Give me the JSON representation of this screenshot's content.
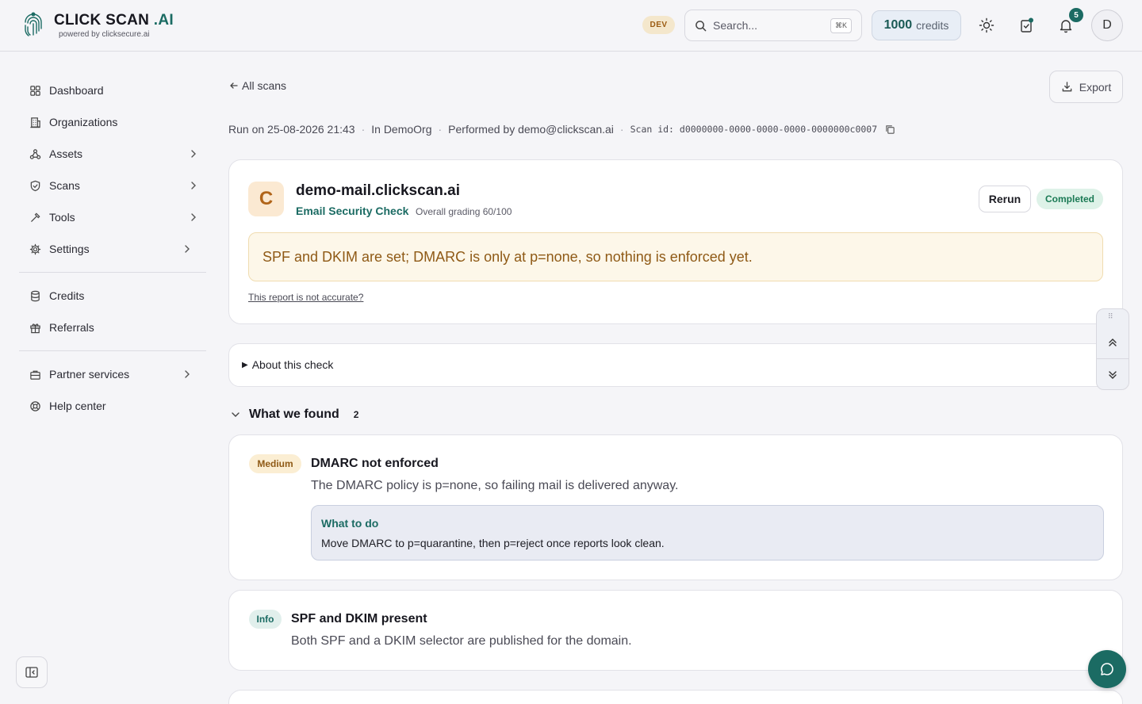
{
  "header": {
    "brand_main": "CLICK SCAN ",
    "brand_ai": ".AI",
    "brand_sub": "powered by clicksecure.ai",
    "env_badge": "DEV",
    "search_placeholder": "Search...",
    "search_shortcut": "⌘K",
    "credits_value": "1000",
    "credits_label": "credits",
    "notification_count": "5",
    "avatar_initial": "D"
  },
  "sidebar": {
    "items": [
      {
        "label": "Dashboard",
        "icon": "grid-icon"
      },
      {
        "label": "Organizations",
        "icon": "building-icon"
      },
      {
        "label": "Assets",
        "icon": "network-icon"
      },
      {
        "label": "Scans",
        "icon": "shield-icon"
      },
      {
        "label": "Tools",
        "icon": "hammer-icon"
      },
      {
        "label": "Settings",
        "icon": "gear-icon"
      },
      {
        "label": "Credits",
        "icon": "database-icon"
      },
      {
        "label": "Referrals",
        "icon": "gift-icon"
      },
      {
        "label": "Partner services",
        "icon": "briefcase-icon"
      },
      {
        "label": "Help center",
        "icon": "lifebuoy-icon"
      }
    ]
  },
  "main": {
    "back_label": "All scans",
    "export_label": "Export",
    "meta": {
      "run_on": "Run on 25-08-2026 21:43",
      "org": "In DemoOrg",
      "performed_by": "Performed by demo@clickscan.ai",
      "scan_id": "Scan id: d0000000-0000-0000-0000-0000000c0007"
    },
    "result": {
      "grade": "C",
      "domain": "demo-mail.clickscan.ai",
      "check_name": "Email Security Check",
      "grading": "Overall grading 60/100",
      "rerun_label": "Rerun",
      "status": "Completed",
      "summary": "SPF and DKIM are set; DMARC is only at p=none, so nothing is enforced yet.",
      "accuracy_link": "This report is not accurate?"
    },
    "about_label": "About this check",
    "findings_title": "What we found",
    "findings_count": "2",
    "findings": [
      {
        "severity": "Medium",
        "title": "DMARC not enforced",
        "description": "The DMARC policy is p=none, so failing mail is delivered anyway.",
        "todo_heading": "What to do",
        "todo_text": "Move DMARC to p=quarantine, then p=reject once reports look clean."
      },
      {
        "severity": "Info",
        "title": "SPF and DKIM present",
        "description": "Both SPF and a DKIM selector are published for the domain."
      }
    ]
  },
  "colors": {
    "accent": "#1b6b63",
    "warning_bg": "#fdf7e9",
    "warning_text": "#8f5a16",
    "success_bg": "#def2e8"
  }
}
